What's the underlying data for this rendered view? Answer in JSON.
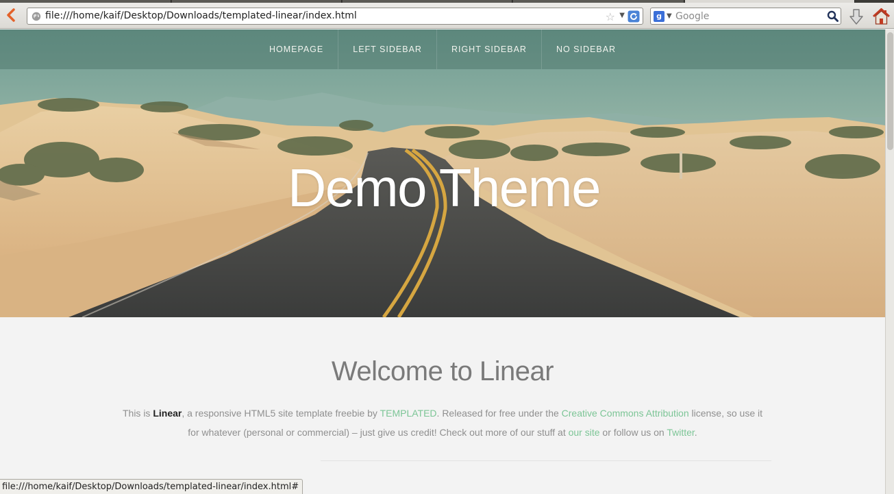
{
  "browser": {
    "url": "file:///home/kaif/Desktop/Downloads/templated-linear/index.html",
    "search_placeholder": "Google",
    "search_engine_icon": "google-icon",
    "status_text": "file:///home/kaif/Desktop/Downloads/templated-linear/index.html#"
  },
  "nav": {
    "items": [
      {
        "label": "HOMEPAGE"
      },
      {
        "label": "LEFT SIDEBAR"
      },
      {
        "label": "RIGHT SIDEBAR"
      },
      {
        "label": "NO SIDEBAR"
      }
    ]
  },
  "hero": {
    "title": "Demo Theme"
  },
  "welcome": {
    "heading": "Welcome to Linear",
    "p1": "This is ",
    "brand": "Linear",
    "p2": ", a responsive HTML5 site template freebie by ",
    "link_templated": "TEMPLATED",
    "p3": ". Released for free under the ",
    "link_cc": "Creative Commons Attribution",
    "p4": " license, so use it for whatever (personal or commercial) – just give us credit! Check out more of our stuff at ",
    "link_site": "our site",
    "p5": " or follow us on ",
    "link_twitter": "Twitter",
    "p6": "."
  },
  "colors": {
    "link": "#7cc596",
    "heading": "#7a7a7a",
    "body_text": "#8f8f8f",
    "nav_overlay": "#466e64"
  }
}
